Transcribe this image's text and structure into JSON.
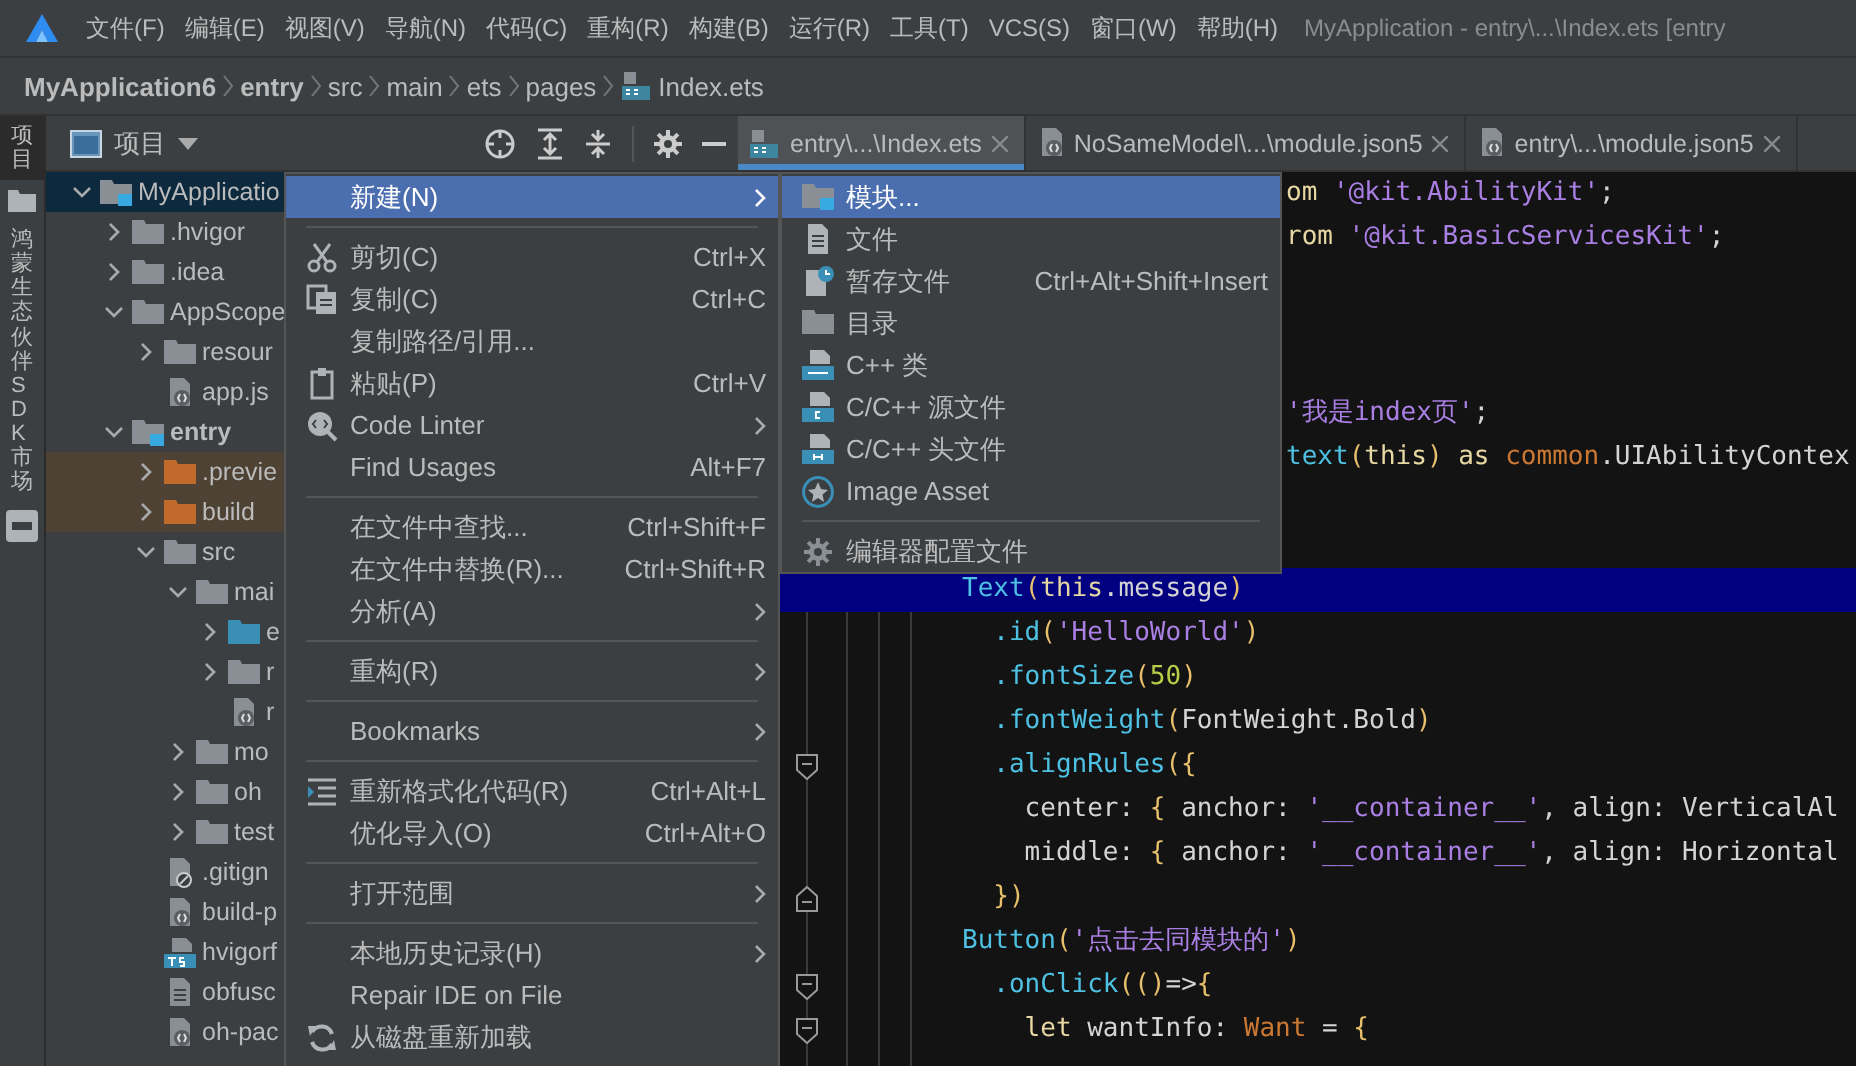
{
  "menubar": {
    "items": [
      "文件(F)",
      "编辑(E)",
      "视图(V)",
      "导航(N)",
      "代码(C)",
      "重构(R)",
      "构建(B)",
      "运行(R)",
      "工具(T)",
      "VCS(S)",
      "窗口(W)",
      "帮助(H)"
    ],
    "title": "MyApplication - entry\\...\\Index.ets [entry"
  },
  "breadcrumb": [
    {
      "label": "MyApplication6",
      "bold": true
    },
    {
      "label": "entry",
      "bold": true
    },
    {
      "label": "src",
      "bold": false
    },
    {
      "label": "main",
      "bold": false
    },
    {
      "label": "ets",
      "bold": false
    },
    {
      "label": "pages",
      "bold": false
    },
    {
      "label": "Index.ets",
      "bold": false
    }
  ],
  "side_strip": {
    "tabs": [
      {
        "label": "项目",
        "selected": true
      },
      {
        "label": "鸿蒙生态伙伴SDK市场",
        "selected": false
      }
    ]
  },
  "project_panel": {
    "title": "项目",
    "tree": [
      {
        "label": "MyApplicatio",
        "kind": "root",
        "selected": true,
        "expanded": true,
        "children": [
          {
            "label": ".hvigor",
            "kind": "folder",
            "selected": false,
            "expanded": false
          },
          {
            "label": ".idea",
            "kind": "folder",
            "selected": false,
            "expanded": false
          },
          {
            "label": "AppScope",
            "kind": "folder",
            "selected": false,
            "expanded": true,
            "children": [
              {
                "label": "resour",
                "kind": "folder",
                "selected": false,
                "expanded": false
              },
              {
                "label": "app.js",
                "kind": "json-file",
                "selected": false
              }
            ]
          },
          {
            "label": "entry",
            "kind": "module",
            "selected": false,
            "expanded": true,
            "children": [
              {
                "label": ".previe",
                "kind": "excluded-folder",
                "selected": false,
                "expanded": false
              },
              {
                "label": "build",
                "kind": "excluded-folder",
                "selected": false,
                "expanded": false
              },
              {
                "label": "src",
                "kind": "folder",
                "selected": false,
                "expanded": true,
                "children": [
                  {
                    "label": "mai",
                    "kind": "folder",
                    "selected": false,
                    "expanded": true,
                    "children": [
                      {
                        "label": "e",
                        "kind": "source-folder",
                        "selected": false,
                        "expanded": false
                      },
                      {
                        "label": "r",
                        "kind": "folder",
                        "selected": false,
                        "expanded": false
                      },
                      {
                        "label": "r",
                        "kind": "json-file",
                        "selected": false
                      }
                    ]
                  },
                  {
                    "label": "mo",
                    "kind": "folder",
                    "selected": false,
                    "expanded": false
                  },
                  {
                    "label": "oh",
                    "kind": "folder",
                    "selected": false,
                    "expanded": false
                  },
                  {
                    "label": "test",
                    "kind": "folder",
                    "selected": false,
                    "expanded": false
                  }
                ]
              },
              {
                "label": ".gitign",
                "kind": "ignore-file",
                "selected": false
              },
              {
                "label": "build-p",
                "kind": "json-file",
                "selected": false
              },
              {
                "label": "hvigorf",
                "kind": "ts-file",
                "selected": false
              },
              {
                "label": "obfusc",
                "kind": "text-file",
                "selected": false
              },
              {
                "label": "oh-pac",
                "kind": "json-file",
                "selected": false
              }
            ]
          }
        ]
      }
    ]
  },
  "editor_tabs": [
    {
      "label": "entry\\...\\Index.ets",
      "kind": "ets",
      "selected": true
    },
    {
      "label": "NoSameModel\\...\\module.json5",
      "kind": "json",
      "selected": false
    },
    {
      "label": "entry\\...\\module.json5",
      "kind": "json",
      "selected": false
    }
  ],
  "code": [
    {
      "kind": "partial",
      "tokens": [
        {
          "kind": "kw",
          "text": "om"
        },
        {
          "kind": "str",
          "text": " '@kit.AbilityKit'"
        },
        {
          "kind": "plain",
          "text": ";"
        }
      ]
    },
    {
      "kind": "partial",
      "tokens": [
        {
          "kind": "kw",
          "text": "rom"
        },
        {
          "kind": "str",
          "text": " '@kit.BasicServicesKit'"
        },
        {
          "kind": "plain",
          "text": ";"
        }
      ]
    },
    {
      "kind": "blank"
    },
    {
      "kind": "blank"
    },
    {
      "kind": "blank"
    },
    {
      "kind": "partial",
      "tokens": [
        {
          "kind": "str",
          "text": "'我是index页'"
        },
        {
          "kind": "plain",
          "text": ";"
        }
      ]
    },
    {
      "kind": "partial",
      "tokens": [
        {
          "kind": "fn",
          "text": "text"
        },
        {
          "kind": "brace",
          "text": "("
        },
        {
          "kind": "kw",
          "text": "this"
        },
        {
          "kind": "brace",
          "text": ")"
        },
        {
          "kind": "kw",
          "text": " as"
        },
        {
          "kind": "type",
          "text": " common"
        },
        {
          "kind": "plain",
          "text": ".UIAbilityContex"
        }
      ]
    },
    {
      "kind": "blank"
    },
    {
      "kind": "blank"
    },
    {
      "kind": "code",
      "highlighted": true,
      "tokens": [
        {
          "kind": "fn",
          "text": "Text"
        },
        {
          "kind": "brace",
          "text": "("
        },
        {
          "kind": "kw",
          "text": "this"
        },
        {
          "kind": "plain",
          "text": ".message"
        },
        {
          "kind": "brace",
          "text": ")"
        }
      ],
      "children": [
        {
          "kind": "code",
          "highlighted": false,
          "tokens": [
            {
              "kind": "fn",
              "text": ".id"
            },
            {
              "kind": "brace",
              "text": "("
            },
            {
              "kind": "str",
              "text": "'HelloWorld'"
            },
            {
              "kind": "brace",
              "text": ")"
            }
          ]
        },
        {
          "kind": "code",
          "highlighted": false,
          "tokens": [
            {
              "kind": "fn",
              "text": ".fontSize"
            },
            {
              "kind": "brace",
              "text": "("
            },
            {
              "kind": "num",
              "text": "50"
            },
            {
              "kind": "brace",
              "text": ")"
            }
          ]
        },
        {
          "kind": "code",
          "highlighted": false,
          "tokens": [
            {
              "kind": "fn",
              "text": ".fontWeight"
            },
            {
              "kind": "brace",
              "text": "("
            },
            {
              "kind": "plain",
              "text": "FontWeight.Bold"
            },
            {
              "kind": "brace",
              "text": ")"
            }
          ]
        },
        {
          "kind": "code",
          "highlighted": false,
          "fold_start": true,
          "tokens": [
            {
              "kind": "fn",
              "text": ".alignRules"
            },
            {
              "kind": "brace",
              "text": "({"
            }
          ],
          "children": [
            {
              "kind": "code",
              "highlighted": false,
              "tokens": [
                {
                  "kind": "plain",
                  "text": "center:"
                },
                {
                  "kind": "brace",
                  "text": " {"
                },
                {
                  "kind": "plain",
                  "text": " anchor:"
                },
                {
                  "kind": "str",
                  "text": " '__container__'"
                },
                {
                  "kind": "plain",
                  "text": ", align: VerticalAl"
                }
              ]
            },
            {
              "kind": "code",
              "highlighted": false,
              "tokens": [
                {
                  "kind": "plain",
                  "text": "middle:"
                },
                {
                  "kind": "brace",
                  "text": " {"
                },
                {
                  "kind": "plain",
                  "text": " anchor:"
                },
                {
                  "kind": "str",
                  "text": " '__container__'"
                },
                {
                  "kind": "plain",
                  "text": ", align: Horizontal"
                }
              ]
            }
          ]
        },
        {
          "kind": "code",
          "highlighted": false,
          "fold_end": true,
          "tokens": [
            {
              "kind": "brace",
              "text": "})"
            }
          ]
        }
      ]
    },
    {
      "kind": "code",
      "highlighted": false,
      "tokens": [
        {
          "kind": "fn",
          "text": "Button"
        },
        {
          "kind": "brace",
          "text": "("
        },
        {
          "kind": "str",
          "text": "'点击去同模块的'"
        },
        {
          "kind": "brace",
          "text": ")"
        }
      ],
      "children": [
        {
          "kind": "code",
          "highlighted": false,
          "fold_start": true,
          "tokens": [
            {
              "kind": "fn",
              "text": ".onClick"
            },
            {
              "kind": "brace",
              "text": "(()"
            },
            {
              "kind": "plain",
              "text": "=>"
            },
            {
              "kind": "brace",
              "text": "{"
            }
          ],
          "children": [
            {
              "kind": "code",
              "highlighted": false,
              "fold_start": true,
              "tokens": [
                {
                  "kind": "kw",
                  "text": "let"
                },
                {
                  "kind": "plain",
                  "text": " wantInfo:"
                },
                {
                  "kind": "type",
                  "text": " Want"
                },
                {
                  "kind": "plain",
                  "text": " ="
                },
                {
                  "kind": "brace",
                  "text": " {"
                }
              ]
            }
          ]
        }
      ]
    }
  ],
  "context_menu": [
    {
      "kind": "item",
      "label": "新建(N)",
      "submenu": true,
      "selected": true
    },
    {
      "kind": "separator"
    },
    {
      "kind": "item",
      "label": "剪切(C)",
      "shortcut": "Ctrl+X",
      "selected": false
    },
    {
      "kind": "item",
      "label": "复制(C)",
      "shortcut": "Ctrl+C",
      "selected": false
    },
    {
      "kind": "item",
      "label": "复制路径/引用...",
      "selected": false
    },
    {
      "kind": "item",
      "label": "粘贴(P)",
      "shortcut": "Ctrl+V",
      "selected": false
    },
    {
      "kind": "item",
      "label": "Code Linter",
      "submenu": true,
      "selected": false
    },
    {
      "kind": "item",
      "label": "Find Usages",
      "shortcut": "Alt+F7",
      "selected": false
    },
    {
      "kind": "separator"
    },
    {
      "kind": "item",
      "label": "在文件中查找...",
      "shortcut": "Ctrl+Shift+F",
      "selected": false
    },
    {
      "kind": "item",
      "label": "在文件中替换(R)...",
      "shortcut": "Ctrl+Shift+R",
      "selected": false
    },
    {
      "kind": "item",
      "label": "分析(A)",
      "submenu": true,
      "selected": false
    },
    {
      "kind": "separator"
    },
    {
      "kind": "item",
      "label": "重构(R)",
      "submenu": true,
      "selected": false
    },
    {
      "kind": "separator"
    },
    {
      "kind": "item",
      "label": "Bookmarks",
      "submenu": true,
      "selected": false
    },
    {
      "kind": "separator"
    },
    {
      "kind": "item",
      "label": "重新格式化代码(R)",
      "shortcut": "Ctrl+Alt+L",
      "selected": false
    },
    {
      "kind": "item",
      "label": "优化导入(O)",
      "shortcut": "Ctrl+Alt+O",
      "selected": false
    },
    {
      "kind": "separator"
    },
    {
      "kind": "item",
      "label": "打开范围",
      "submenu": true,
      "selected": false
    },
    {
      "kind": "separator"
    },
    {
      "kind": "item",
      "label": "本地历史记录(H)",
      "submenu": true,
      "selected": false
    },
    {
      "kind": "item",
      "label": "Repair IDE on File",
      "selected": false
    },
    {
      "kind": "item",
      "label": "从磁盘重新加载",
      "selected": false
    }
  ],
  "submenu": [
    {
      "kind": "item",
      "label": "模块...",
      "selected": true
    },
    {
      "kind": "item",
      "label": "文件",
      "selected": false
    },
    {
      "kind": "item",
      "label": "暂存文件",
      "shortcut": "Ctrl+Alt+Shift+Insert",
      "selected": false
    },
    {
      "kind": "item",
      "label": "目录",
      "selected": false
    },
    {
      "kind": "item",
      "label": "C++ 类",
      "selected": false
    },
    {
      "kind": "item",
      "label": "C/C++ 源文件",
      "selected": false
    },
    {
      "kind": "item",
      "label": "C/C++ 头文件",
      "selected": false
    },
    {
      "kind": "item",
      "label": "Image Asset",
      "selected": false
    },
    {
      "kind": "separator"
    },
    {
      "kind": "item",
      "label": "编辑器配置文件",
      "selected": false
    }
  ]
}
